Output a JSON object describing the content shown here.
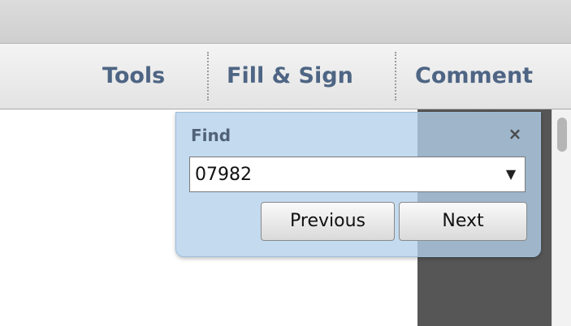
{
  "toolbar": {
    "tools_label": "Tools",
    "fill_sign_label": "Fill & Sign",
    "comment_label": "Comment"
  },
  "find_panel": {
    "title": "Find",
    "close_glyph": "×",
    "search_value": "07982",
    "dropdown_glyph": "▼",
    "previous_label": "Previous",
    "next_label": "Next"
  },
  "icons": {
    "close": "close-icon",
    "dropdown": "chevron-down-icon"
  },
  "colors": {
    "toolbar_text": "#4e6584",
    "find_panel_bg": "#b2d0ea",
    "dark_panel": "#565656"
  }
}
